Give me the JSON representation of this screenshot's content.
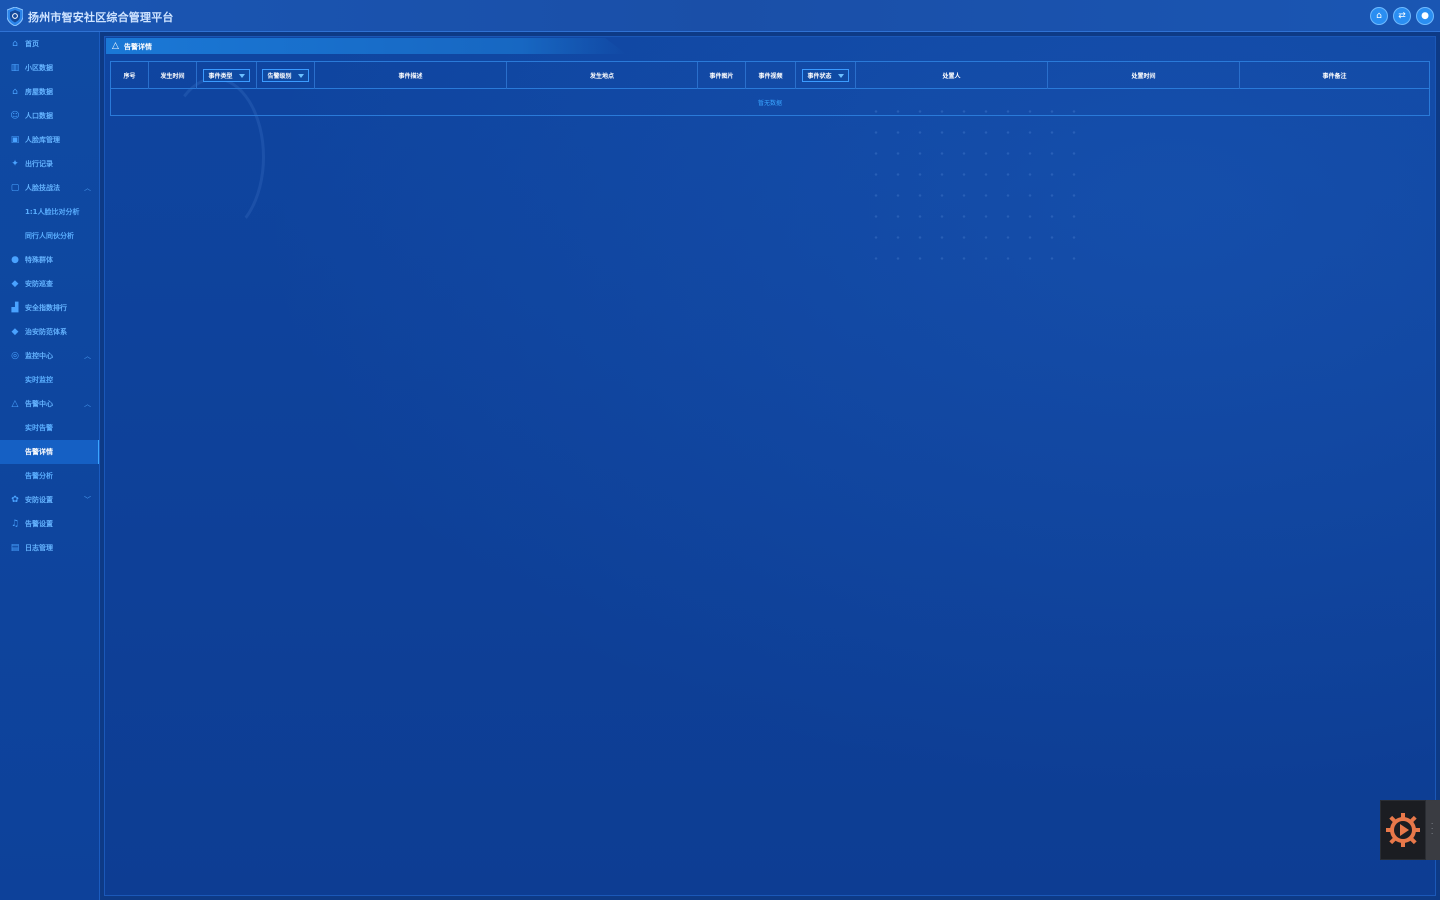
{
  "app": {
    "title": "扬州市智安社区综合管理平台"
  },
  "top_actions": [
    {
      "icon": "home-icon",
      "glyph": "⌂"
    },
    {
      "icon": "switch-icon",
      "glyph": "⇄"
    },
    {
      "icon": "user-icon",
      "glyph": "●"
    }
  ],
  "sidebar": {
    "items": [
      {
        "label": "首页",
        "icon": "home-icon",
        "glyph": "⌂",
        "type": "item"
      },
      {
        "label": "小区数据",
        "icon": "building-icon",
        "glyph": "▥",
        "type": "item"
      },
      {
        "label": "房屋数据",
        "icon": "house-icon",
        "glyph": "⌂",
        "type": "item"
      },
      {
        "label": "人口数据",
        "icon": "people-icon",
        "glyph": "☺",
        "type": "item"
      },
      {
        "label": "人脸库管理",
        "icon": "id-card-icon",
        "glyph": "▣",
        "type": "item"
      },
      {
        "label": "出行记录",
        "icon": "walking-icon",
        "glyph": "✦",
        "type": "item"
      },
      {
        "label": "人脸技战法",
        "icon": "face-scan-icon",
        "glyph": "▢",
        "type": "group",
        "caret": "^"
      },
      {
        "label": "1:1人脸比对分析",
        "type": "sub"
      },
      {
        "label": "同行人同伙分析",
        "type": "sub"
      },
      {
        "label": "特殊群体",
        "icon": "person-icon",
        "glyph": "●",
        "type": "item"
      },
      {
        "label": "安防巡查",
        "icon": "shield-icon",
        "glyph": "◆",
        "type": "item"
      },
      {
        "label": "安全指数排行",
        "icon": "bar-chart-icon",
        "glyph": "▟",
        "type": "item"
      },
      {
        "label": "治安防范体系",
        "icon": "shield-check-icon",
        "glyph": "◆",
        "type": "item"
      },
      {
        "label": "监控中心",
        "icon": "camera-icon",
        "glyph": "◎",
        "type": "group",
        "caret": "^"
      },
      {
        "label": "实时监控",
        "type": "sub"
      },
      {
        "label": "告警中心",
        "icon": "warning-icon",
        "glyph": "△",
        "type": "group",
        "caret": "^"
      },
      {
        "label": "实时告警",
        "type": "sub"
      },
      {
        "label": "告警详情",
        "type": "sub",
        "active": true
      },
      {
        "label": "告警分析",
        "type": "sub"
      },
      {
        "label": "安防设置",
        "icon": "settings-icon",
        "glyph": "✿",
        "type": "group",
        "caret": "v"
      },
      {
        "label": "告警设置",
        "icon": "bell-icon",
        "glyph": "♫",
        "type": "item"
      },
      {
        "label": "日志管理",
        "icon": "log-icon",
        "glyph": "▤",
        "type": "item"
      }
    ]
  },
  "panel": {
    "title": "告警详情",
    "icon": "warning-icon"
  },
  "table": {
    "columns": [
      {
        "label": "序号",
        "type": "text"
      },
      {
        "label": "发生时间",
        "type": "text"
      },
      {
        "label": "事件类型",
        "type": "select"
      },
      {
        "label": "告警级别",
        "type": "select"
      },
      {
        "label": "事件描述",
        "type": "text"
      },
      {
        "label": "发生地点",
        "type": "text"
      },
      {
        "label": "事件图片",
        "type": "text"
      },
      {
        "label": "事件视频",
        "type": "text"
      },
      {
        "label": "事件状态",
        "type": "select"
      },
      {
        "label": "处置人",
        "type": "text"
      },
      {
        "label": "处置时间",
        "type": "text"
      },
      {
        "label": "事件备注",
        "type": "text"
      }
    ],
    "empty_text": "暂无数据"
  },
  "colors": {
    "accent": "#3ba6ff",
    "nav_text": "#64b3ff",
    "background": "#0d3a86"
  }
}
